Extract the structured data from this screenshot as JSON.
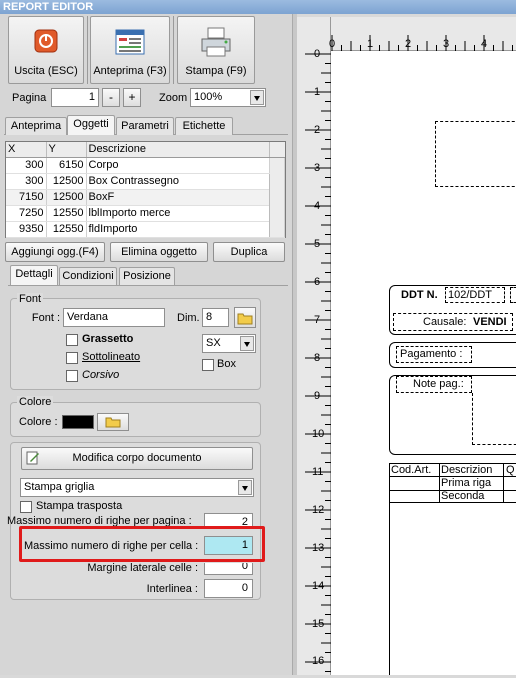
{
  "window": {
    "title": "REPORT EDITOR"
  },
  "toolbar": {
    "exit_label": "Uscita (ESC)",
    "preview_label": "Anteprima (F3)",
    "print_label": "Stampa (F9)"
  },
  "pager": {
    "page_label": "Pagina",
    "page_value": "1",
    "minus_label": "-",
    "plus_label": "+",
    "zoom_label": "Zoom",
    "zoom_value": "100%"
  },
  "tabs": [
    "Anteprima",
    "Oggetti",
    "Parametri",
    "Etichette"
  ],
  "objects_table": {
    "headers": [
      "X",
      "Y",
      "Descrizione"
    ],
    "rows": [
      [
        "300",
        "6150",
        "Corpo"
      ],
      [
        "300",
        "12500",
        "Box Contrassegno"
      ],
      [
        "7150",
        "12500",
        "BoxF"
      ],
      [
        "7250",
        "12550",
        "lblImporto merce"
      ],
      [
        "9350",
        "12550",
        "fldImporto"
      ]
    ]
  },
  "object_buttons": {
    "add": "Aggiungi ogg.(F4)",
    "delete": "Elimina oggetto",
    "duplicate": "Duplica"
  },
  "subtabs": [
    "Dettagli",
    "Condizioni",
    "Posizione"
  ],
  "font_group": {
    "title": "Font",
    "font_label": "Font :",
    "font_value": "Verdana",
    "dim_label": "Dim.",
    "dim_value": "8",
    "bold_label": "Grassetto",
    "underline_label": "Sottolineato",
    "italic_label": "Corsivo",
    "align_value": "SX",
    "box_label": "Box"
  },
  "color_group": {
    "title": "Colore",
    "color_label": "Colore :",
    "swatch_color": "#000000"
  },
  "body_group": {
    "modify_button": "Modifica corpo documento",
    "grid_select": "Stampa griglia",
    "transposed_label": "Stampa trasposta",
    "max_rows_page_label": "Massimo numero di righe per pagina :",
    "max_rows_page_value": "2",
    "max_rows_cell_label": "Massimo numero di righe per cella :",
    "max_rows_cell_value": "1",
    "margin_label": "Margine laterale celle :",
    "margin_value": "0",
    "interline_label": "Interlinea :",
    "interline_value": "0"
  },
  "highlight_color": "#e01a1a",
  "ruler": {
    "top": [
      "0",
      "1",
      "2",
      "3",
      "4"
    ],
    "left": [
      "0",
      "1",
      "2",
      "3",
      "4",
      "5",
      "6",
      "7",
      "8",
      "9",
      "10",
      "11",
      "12",
      "13",
      "14",
      "15",
      "16"
    ]
  },
  "preview": {
    "ddt_label": "DDT N.",
    "ddt_value": "102/DDT",
    "causale_label": "Causale:",
    "causale_value": "VENDI",
    "payment_label": "Pagamento :",
    "notes_label": "Note pag.:",
    "col_code": "Cod.Art.",
    "col_desc": "Descrizion",
    "col_q": "Q",
    "row1": "Prima riga",
    "row2": "Seconda"
  }
}
